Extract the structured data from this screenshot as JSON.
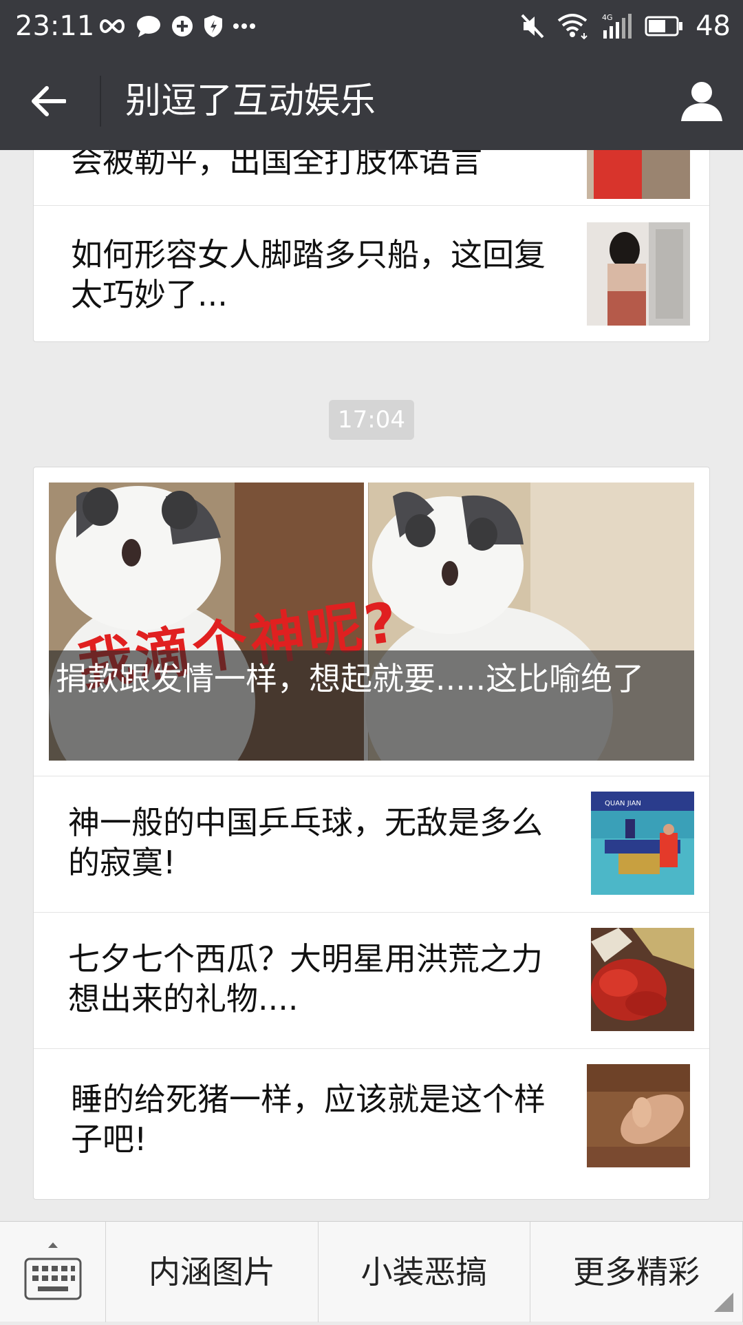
{
  "status_bar": {
    "time": "23:11",
    "battery": "48",
    "network": "4G",
    "left_icons": [
      "infinity-icon",
      "chat-bubble-icon",
      "sync-icon",
      "shield-icon",
      "more-dots-icon"
    ],
    "right_icons": [
      "mute-icon",
      "wifi-icon",
      "signal-icon",
      "battery-icon"
    ]
  },
  "header": {
    "title": "别逗了互动娱乐",
    "back_icon": "back-arrow-icon",
    "profile_icon": "profile-icon"
  },
  "card_top": {
    "articles": [
      {
        "title": "会被勒平，出国全打肢体语言"
      },
      {
        "title": "如何形容女人脚踏多只船，这回复太巧妙了..."
      }
    ]
  },
  "timestamp": "17:04",
  "card_main": {
    "hero": {
      "image_text": "我滴个神呢?",
      "caption": "捐款跟发情一样，想起就要.....这比喻绝了"
    },
    "articles": [
      {
        "title": "神一般的中国乒乓球，无敌是多么的寂寞!"
      },
      {
        "title": "七夕七个西瓜？大明星用洪荒之力想出来的礼物...."
      },
      {
        "title": "睡的给死猪一样，应该就是这个样子吧!"
      }
    ],
    "thumb_text": "QUAN JIAN"
  },
  "bottom_menu": {
    "keyboard_icon": "keyboard-icon",
    "items": [
      {
        "label": "内涵图片"
      },
      {
        "label": "小装恶搞"
      },
      {
        "label": "更多精彩"
      }
    ]
  },
  "colors": {
    "bar_bg": "#393a3f",
    "page_bg": "#ebebeb",
    "timestamp_bg": "#d5d5d5"
  }
}
